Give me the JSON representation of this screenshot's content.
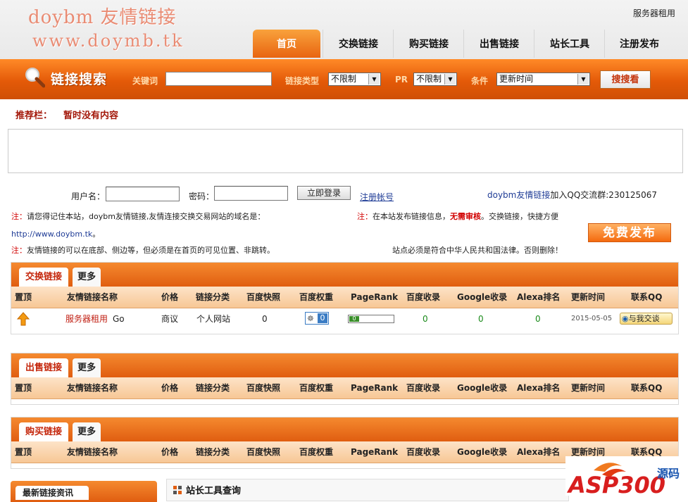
{
  "header": {
    "logo_line1": "doybm 友情链接",
    "logo_line2": "www.doymb.tk",
    "server_rent": "服务器租用"
  },
  "nav": [
    "首页",
    "交换链接",
    "购买链接",
    "出售链接",
    "站长工具",
    "注册发布"
  ],
  "search": {
    "title": "链接搜索",
    "keyword_label": "关键词",
    "type_label": "链接类型",
    "type_value": "不限制",
    "pr_label": "PR",
    "pr_value": "不限制",
    "cond_label": "条件",
    "cond_value": "更新时间",
    "button": "搜搜看"
  },
  "recommend": {
    "label": "推荐栏：",
    "text": "暂时没有内容"
  },
  "login": {
    "username_label": "用户名：",
    "password_label": "密码：",
    "login_button": "立即登录",
    "register_link": "注册帐号",
    "qq_group_site": "doybm友情链接",
    "qq_group_text": "加入QQ交流群:230125067",
    "note1_prefix": "注：",
    "note1_text": "请您得记住本站，doybm友情链接,友情连接交换交易网站的域名是：",
    "note1_url": "http://www.doybm.tk",
    "note1_end": "。",
    "note2_prefix": "注：",
    "note2_text": "友情链接的可以在底部、侧边等，但必须是在首页的可见位置、非跳转。",
    "note3_prefix": "注：",
    "note3_text1": "在本站发布链接信息，",
    "note3_highlight": "无需审核",
    "note3_text2": "。交换链接，快捷方便",
    "note4_text": "站点必须是符合中华人民共和国法律。否则删除！",
    "free_publish": "免费发布"
  },
  "columns": [
    "置顶",
    "友情链接名称",
    "价格",
    "链接分类",
    "百度快照",
    "百度权重",
    "PageRank",
    "百度收录",
    "Google收录",
    "Alexa排名",
    "更新时间",
    "联系QQ"
  ],
  "panels": [
    {
      "tab": "交换链接",
      "more": "更多",
      "rows": [
        {
          "name": "服务器租用",
          "go": "Go",
          "price": "商议",
          "category": "个人网站",
          "snapshot": "0",
          "weight": "0",
          "pagerank": "0",
          "baidu_index": "0",
          "google_index": "0",
          "alexa": "0",
          "updated": "2015-05-05",
          "qq": "与我交谈"
        }
      ]
    },
    {
      "tab": "出售链接",
      "more": "更多",
      "rows": []
    },
    {
      "tab": "购买链接",
      "more": "更多",
      "rows": []
    }
  ],
  "bottom": {
    "news_tab": "最新链接资讯",
    "tools_title": "站长工具查询"
  }
}
